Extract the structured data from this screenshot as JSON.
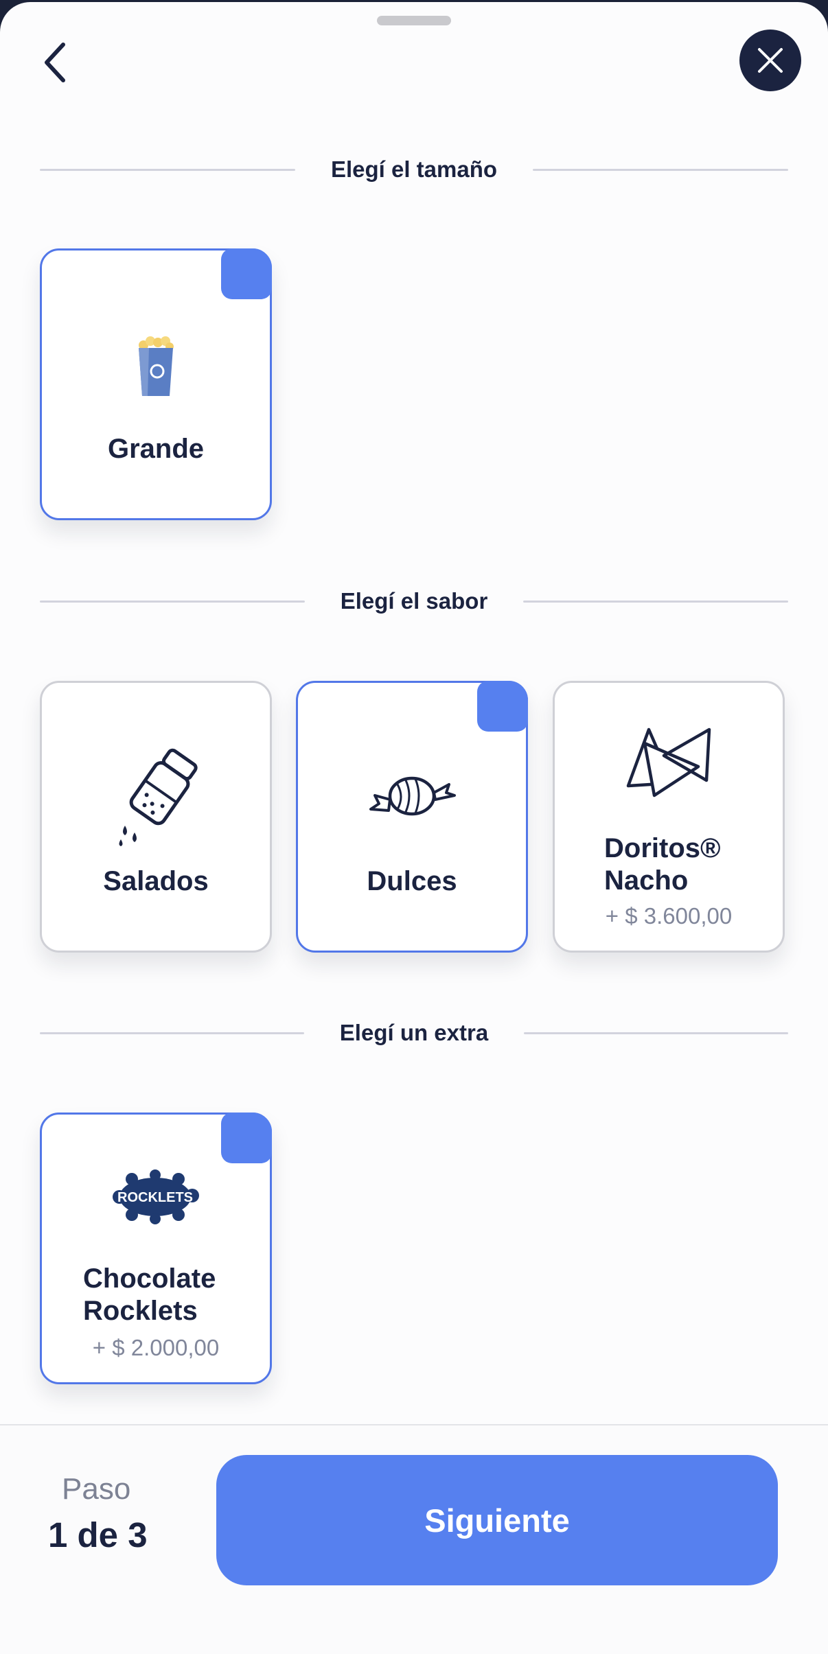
{
  "header": {
    "back_icon": "chevron-left-icon",
    "close_icon": "close-icon"
  },
  "sections": {
    "size": {
      "title": "Elegí el tamaño",
      "options": [
        {
          "label": "Grande",
          "selected": true,
          "icon": "popcorn-bag-icon"
        }
      ]
    },
    "flavor": {
      "title": "Elegí el sabor",
      "options": [
        {
          "label": "Salados",
          "selected": false,
          "icon": "salt-shaker-icon"
        },
        {
          "label": "Dulces",
          "selected": true,
          "icon": "candy-icon"
        },
        {
          "label": "Doritos® Nacho",
          "price": "+ $ 3.600,00",
          "selected": false,
          "icon": "nacho-chips-icon"
        }
      ]
    },
    "extra": {
      "title": "Elegí un extra",
      "options": [
        {
          "label": "Chocolate Rocklets",
          "price": "+ $ 2.000,00",
          "selected": true,
          "icon": "rocklets-logo",
          "logo_text": "ROCKLETS"
        }
      ]
    }
  },
  "footer": {
    "step_label": "Paso",
    "step_value": "1 de 3",
    "next_label": "Siguiente"
  },
  "colors": {
    "accent": "#5680ef",
    "navy": "#1b2340",
    "muted": "#80869a"
  }
}
